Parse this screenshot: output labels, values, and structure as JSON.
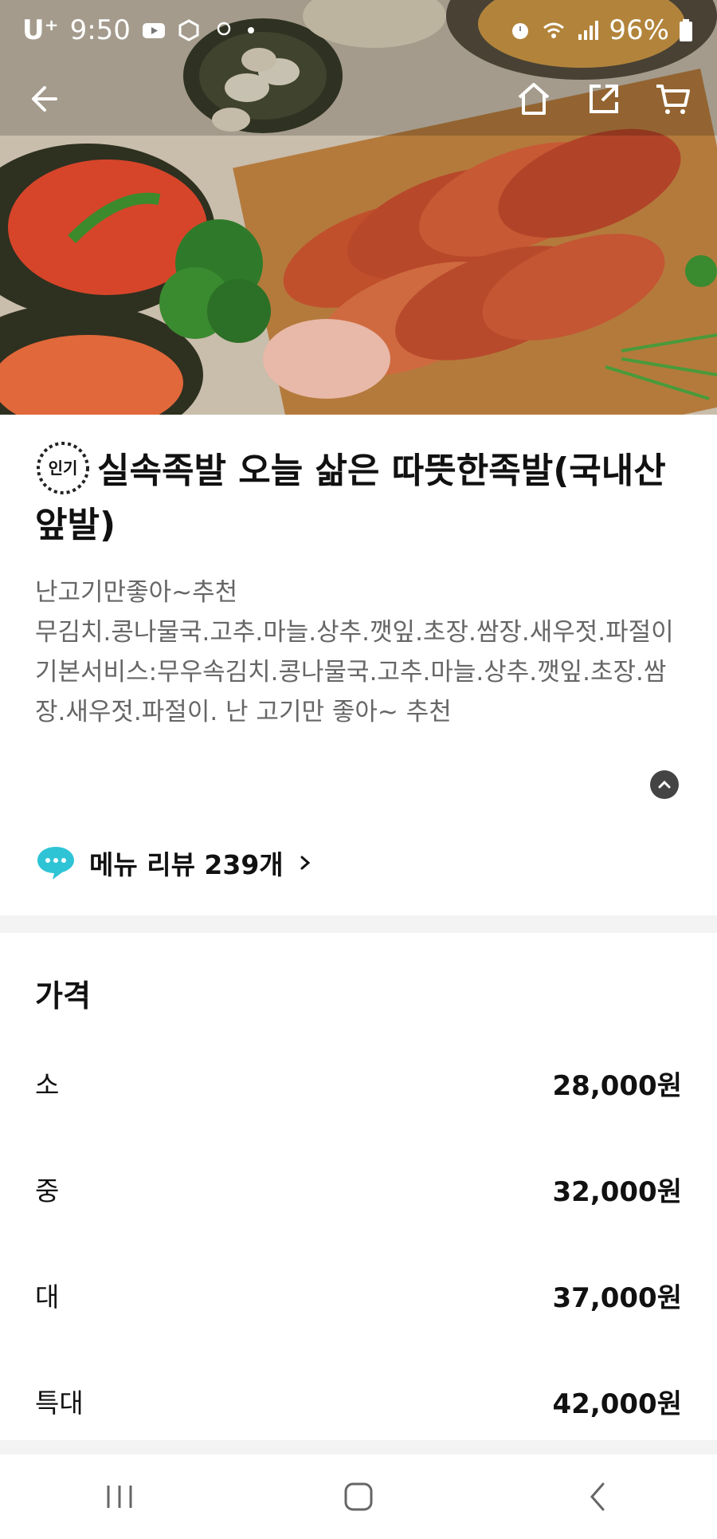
{
  "status_bar": {
    "carrier": "U⁺",
    "time": "9:50",
    "battery": "96%"
  },
  "product": {
    "badge_text": "인기",
    "title": "실속족발 오늘 삶은 따뜻한족발(국내산앞발)",
    "description": "난고기만좋아~추천\n무김치.콩나물국.고추.마늘.상추.깻잎.초장.쌈장.새우젓.파절이\n기본서비스:무우속김치.콩나물국.고추.마늘.상추.깻잎.초장.쌈장.새우젓.파절이. 난 고기만 좋아~  추천"
  },
  "review": {
    "label": "메뉴 리뷰 239개"
  },
  "price": {
    "title": "가격",
    "options": [
      {
        "size": "소",
        "amount": "28,000원"
      },
      {
        "size": "중",
        "amount": "32,000원"
      },
      {
        "size": "대",
        "amount": "37,000원"
      },
      {
        "size": "특대",
        "amount": "42,000원"
      }
    ]
  },
  "icons": {
    "back": "back-arrow-icon",
    "home": "home-icon",
    "share": "share-icon",
    "cart": "cart-icon",
    "collapse": "chevron-up-icon",
    "review": "chat-bubble-icon"
  },
  "colors": {
    "review_bubble": "#2ec4d6",
    "badge_ring": "#222222"
  }
}
